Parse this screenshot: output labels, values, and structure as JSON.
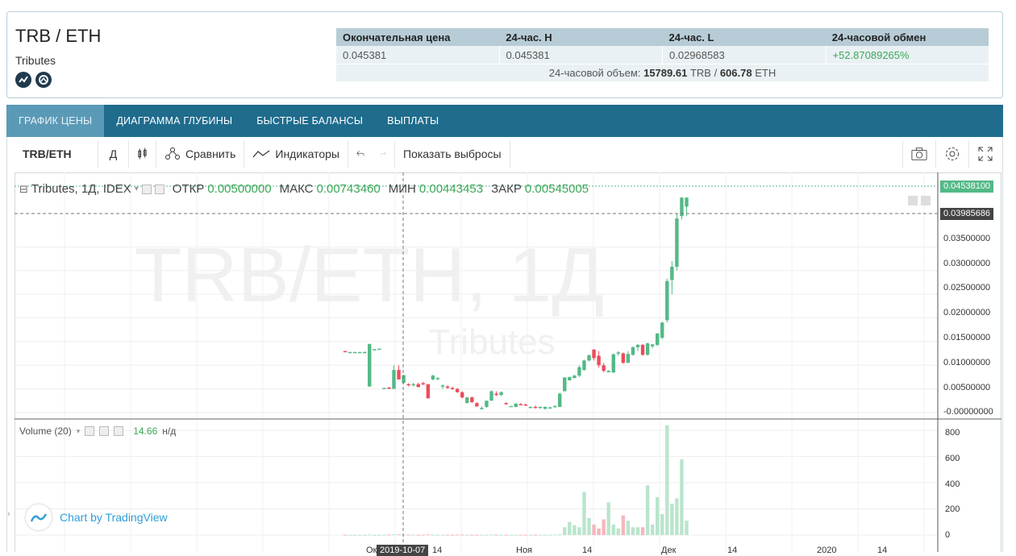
{
  "pair": {
    "title": "TRB / ETH",
    "subtitle": "Tributes",
    "icons": [
      "coinmarketcap-icon",
      "coingecko-icon"
    ]
  },
  "stats": {
    "headers": [
      "Окончательная цена",
      "24-час. H",
      "24-час. L",
      "24-часовой обмен"
    ],
    "values": [
      "0.045381",
      "0.045381",
      "0.02968583",
      "+52.87089265%"
    ],
    "volume_label": "24-часовой объем:",
    "volume_trb": "15789.61",
    "volume_trb_unit": "TRB /",
    "volume_eth": "606.78",
    "volume_eth_unit": "ETH"
  },
  "tabs": [
    "ГРАФИК ЦЕНЫ",
    "ДИАГРАММА ГЛУБИНЫ",
    "БЫСТРЫЕ БАЛАНСЫ",
    "ВЫПЛАТЫ"
  ],
  "toolbar": {
    "symbol": "TRB/ETH",
    "interval": "Д",
    "compare": "Сравнить",
    "indicators": "Индикаторы",
    "outliers": "Показать выбросы"
  },
  "legend": {
    "series": "Tributes, 1Д, IDEX",
    "open_label": "ОТКР",
    "open": "0.00500000",
    "high_label": "МАКС",
    "high": "0.00743460",
    "low_label": "МИН",
    "low": "0.00443453",
    "close_label": "ЗАКР",
    "close": "0.00545005"
  },
  "watermark": {
    "main": "TRB/ETH, 1Д",
    "sub": "Tributes"
  },
  "volume_legend": {
    "label": "Volume (20)",
    "value": "14.66",
    "extra": "н/д"
  },
  "price_tags": {
    "last": "0.04538100",
    "cursor": "0.03985686"
  },
  "price_axis": [
    "0.03500000",
    "0.03000000",
    "0.02500000",
    "0.02000000",
    "0.01500000",
    "0.01000000",
    "0.00500000",
    "-0.00000000"
  ],
  "volume_axis": [
    "800",
    "600",
    "400",
    "200",
    "0"
  ],
  "time_axis": [
    "Окт",
    "14",
    "Ноя",
    "14",
    "Дек",
    "14",
    "2020",
    "14"
  ],
  "time_cursor": "2019-10-07",
  "attribution": "Chart by TradingView",
  "colors": {
    "up": "#53b987",
    "down": "#eb4d5c",
    "tab_bg": "#1f6c8d",
    "tab_active": "#5a9ab7",
    "accent": "#2e9fd8"
  },
  "chart_data": {
    "type": "candlestick",
    "title": "TRB/ETH, 1Д",
    "ylim": [
      0,
      0.048
    ],
    "volume_ylim": [
      0,
      850
    ],
    "candles": [
      {
        "o": 0.013,
        "h": 0.013,
        "l": 0.0128,
        "c": 0.0128,
        "v": 2
      },
      {
        "o": 0.0128,
        "h": 0.0128,
        "l": 0.0128,
        "c": 0.0128,
        "v": 1
      },
      {
        "o": 0.0128,
        "h": 0.0128,
        "l": 0.0127,
        "c": 0.0128,
        "v": 1
      },
      {
        "o": 0.0128,
        "h": 0.0128,
        "l": 0.0127,
        "c": 0.0128,
        "v": 1
      },
      {
        "o": 0.0128,
        "h": 0.0129,
        "l": 0.0128,
        "c": 0.0128,
        "v": 1
      },
      {
        "o": 0.0055,
        "h": 0.0145,
        "l": 0.0055,
        "c": 0.0145,
        "v": 3
      },
      {
        "o": 0.0133,
        "h": 0.0134,
        "l": 0.0133,
        "c": 0.0134,
        "v": 1
      },
      {
        "o": 0.0134,
        "h": 0.0135,
        "l": 0.0134,
        "c": 0.0135,
        "v": 1
      },
      {
        "o": 0.005,
        "h": 0.0052,
        "l": 0.005,
        "c": 0.0052,
        "v": 2
      },
      {
        "o": 0.0053,
        "h": 0.0054,
        "l": 0.005,
        "c": 0.005,
        "v": 4
      },
      {
        "o": 0.005,
        "h": 0.01,
        "l": 0.005,
        "c": 0.009,
        "v": 5
      },
      {
        "o": 0.009,
        "h": 0.01,
        "l": 0.007,
        "c": 0.007,
        "v": 6
      },
      {
        "o": 0.0063,
        "h": 0.008,
        "l": 0.006,
        "c": 0.0079,
        "v": 4
      },
      {
        "o": 0.006,
        "h": 0.0062,
        "l": 0.0055,
        "c": 0.0058,
        "v": 3
      },
      {
        "o": 0.0058,
        "h": 0.0063,
        "l": 0.0055,
        "c": 0.006,
        "v": 3
      },
      {
        "o": 0.006,
        "h": 0.0063,
        "l": 0.0053,
        "c": 0.0054,
        "v": 2
      },
      {
        "o": 0.0062,
        "h": 0.0065,
        "l": 0.0058,
        "c": 0.006,
        "v": 2
      },
      {
        "o": 0.006,
        "h": 0.006,
        "l": 0.003,
        "c": 0.003,
        "v": 5
      },
      {
        "o": 0.007,
        "h": 0.008,
        "l": 0.0068,
        "c": 0.0078,
        "v": 3
      },
      {
        "o": 0.0072,
        "h": 0.0075,
        "l": 0.0068,
        "c": 0.0073,
        "v": 2
      },
      {
        "o": 0.0055,
        "h": 0.006,
        "l": 0.005,
        "c": 0.0057,
        "v": 2
      },
      {
        "o": 0.0055,
        "h": 0.0058,
        "l": 0.005,
        "c": 0.0052,
        "v": 2
      },
      {
        "o": 0.0052,
        "h": 0.0055,
        "l": 0.0048,
        "c": 0.005,
        "v": 2
      },
      {
        "o": 0.005,
        "h": 0.0052,
        "l": 0.0042,
        "c": 0.0043,
        "v": 3
      },
      {
        "o": 0.0043,
        "h": 0.0045,
        "l": 0.003,
        "c": 0.0032,
        "v": 3
      },
      {
        "o": 0.002,
        "h": 0.0033,
        "l": 0.002,
        "c": 0.0032,
        "v": 2
      },
      {
        "o": 0.0032,
        "h": 0.0034,
        "l": 0.002,
        "c": 0.0022,
        "v": 2
      },
      {
        "o": 0.002,
        "h": 0.0022,
        "l": 0.0012,
        "c": 0.0013,
        "v": 2
      },
      {
        "o": 0.001,
        "h": 0.0013,
        "l": 0.0006,
        "c": 0.001,
        "v": 2
      },
      {
        "o": 0.0012,
        "h": 0.0025,
        "l": 0.001,
        "c": 0.0025,
        "v": 3
      },
      {
        "o": 0.0025,
        "h": 0.0047,
        "l": 0.0025,
        "c": 0.0045,
        "v": 4
      },
      {
        "o": 0.004,
        "h": 0.0045,
        "l": 0.0035,
        "c": 0.0037,
        "v": 2
      },
      {
        "o": 0.0037,
        "h": 0.0045,
        "l": 0.0035,
        "c": 0.0043,
        "v": 2
      },
      {
        "o": 0.002,
        "h": 0.0022,
        "l": 0.0017,
        "c": 0.0019,
        "v": 2
      },
      {
        "o": 0.0012,
        "h": 0.0014,
        "l": 0.0012,
        "c": 0.0014,
        "v": 2
      },
      {
        "o": 0.0012,
        "h": 0.002,
        "l": 0.0011,
        "c": 0.0019,
        "v": 2
      },
      {
        "o": 0.0018,
        "h": 0.002,
        "l": 0.0016,
        "c": 0.0017,
        "v": 2
      },
      {
        "o": 0.0017,
        "h": 0.0019,
        "l": 0.0015,
        "c": 0.0016,
        "v": 2
      },
      {
        "o": 0.001,
        "h": 0.0013,
        "l": 0.001,
        "c": 0.0012,
        "v": 2
      },
      {
        "o": 0.0012,
        "h": 0.0015,
        "l": 0.0009,
        "c": 0.001,
        "v": 2
      },
      {
        "o": 0.001,
        "h": 0.0013,
        "l": 0.0008,
        "c": 0.0012,
        "v": 2
      },
      {
        "o": 0.0008,
        "h": 0.0013,
        "l": 0.0006,
        "c": 0.0012,
        "v": 2
      },
      {
        "o": 0.001,
        "h": 0.0012,
        "l": 0.0009,
        "c": 0.0011,
        "v": 2
      },
      {
        "o": 0.0012,
        "h": 0.0015,
        "l": 0.001,
        "c": 0.0014,
        "v": 3
      },
      {
        "o": 0.0012,
        "h": 0.0042,
        "l": 0.0012,
        "c": 0.004,
        "v": 5
      },
      {
        "o": 0.0045,
        "h": 0.0075,
        "l": 0.0045,
        "c": 0.0074,
        "v": 60
      },
      {
        "o": 0.0068,
        "h": 0.0076,
        "l": 0.0068,
        "c": 0.0075,
        "v": 100
      },
      {
        "o": 0.0073,
        "h": 0.008,
        "l": 0.0072,
        "c": 0.0078,
        "v": 75
      },
      {
        "o": 0.0078,
        "h": 0.01,
        "l": 0.0075,
        "c": 0.0096,
        "v": 60
      },
      {
        "o": 0.009,
        "h": 0.0112,
        "l": 0.0088,
        "c": 0.011,
        "v": 330
      },
      {
        "o": 0.011,
        "h": 0.0123,
        "l": 0.0108,
        "c": 0.0121,
        "v": 130
      },
      {
        "o": 0.0133,
        "h": 0.0134,
        "l": 0.011,
        "c": 0.0115,
        "v": 80
      },
      {
        "o": 0.012,
        "h": 0.013,
        "l": 0.0095,
        "c": 0.01,
        "v": 50
      },
      {
        "o": 0.01,
        "h": 0.0105,
        "l": 0.0085,
        "c": 0.0088,
        "v": 120
      },
      {
        "o": 0.0085,
        "h": 0.009,
        "l": 0.0085,
        "c": 0.0088,
        "v": 250
      },
      {
        "o": 0.0085,
        "h": 0.0125,
        "l": 0.0083,
        "c": 0.0123,
        "v": 80
      },
      {
        "o": 0.0125,
        "h": 0.013,
        "l": 0.012,
        "c": 0.0127,
        "v": 50
      },
      {
        "o": 0.0125,
        "h": 0.0127,
        "l": 0.0103,
        "c": 0.0105,
        "v": 150
      },
      {
        "o": 0.0105,
        "h": 0.013,
        "l": 0.0105,
        "c": 0.0124,
        "v": 110
      },
      {
        "o": 0.0122,
        "h": 0.014,
        "l": 0.012,
        "c": 0.0138,
        "v": 60
      },
      {
        "o": 0.0138,
        "h": 0.0145,
        "l": 0.013,
        "c": 0.0143,
        "v": 60
      },
      {
        "o": 0.0143,
        "h": 0.0145,
        "l": 0.012,
        "c": 0.0122,
        "v": 60
      },
      {
        "o": 0.0122,
        "h": 0.0148,
        "l": 0.012,
        "c": 0.0146,
        "v": 380
      },
      {
        "o": 0.014,
        "h": 0.0145,
        "l": 0.0136,
        "c": 0.0144,
        "v": 80
      },
      {
        "o": 0.0143,
        "h": 0.0168,
        "l": 0.014,
        "c": 0.0167,
        "v": 290
      },
      {
        "o": 0.0158,
        "h": 0.0192,
        "l": 0.0155,
        "c": 0.019,
        "v": 160
      },
      {
        "o": 0.0195,
        "h": 0.0283,
        "l": 0.019,
        "c": 0.0278,
        "v": 840
      },
      {
        "o": 0.028,
        "h": 0.032,
        "l": 0.025,
        "c": 0.0308,
        "v": 240
      },
      {
        "o": 0.0308,
        "h": 0.042,
        "l": 0.03,
        "c": 0.041,
        "v": 280
      },
      {
        "o": 0.0415,
        "h": 0.0455,
        "l": 0.0408,
        "c": 0.0454,
        "v": 580
      },
      {
        "o": 0.0435,
        "h": 0.0455,
        "l": 0.0415,
        "c": 0.0454,
        "v": 110
      }
    ]
  }
}
